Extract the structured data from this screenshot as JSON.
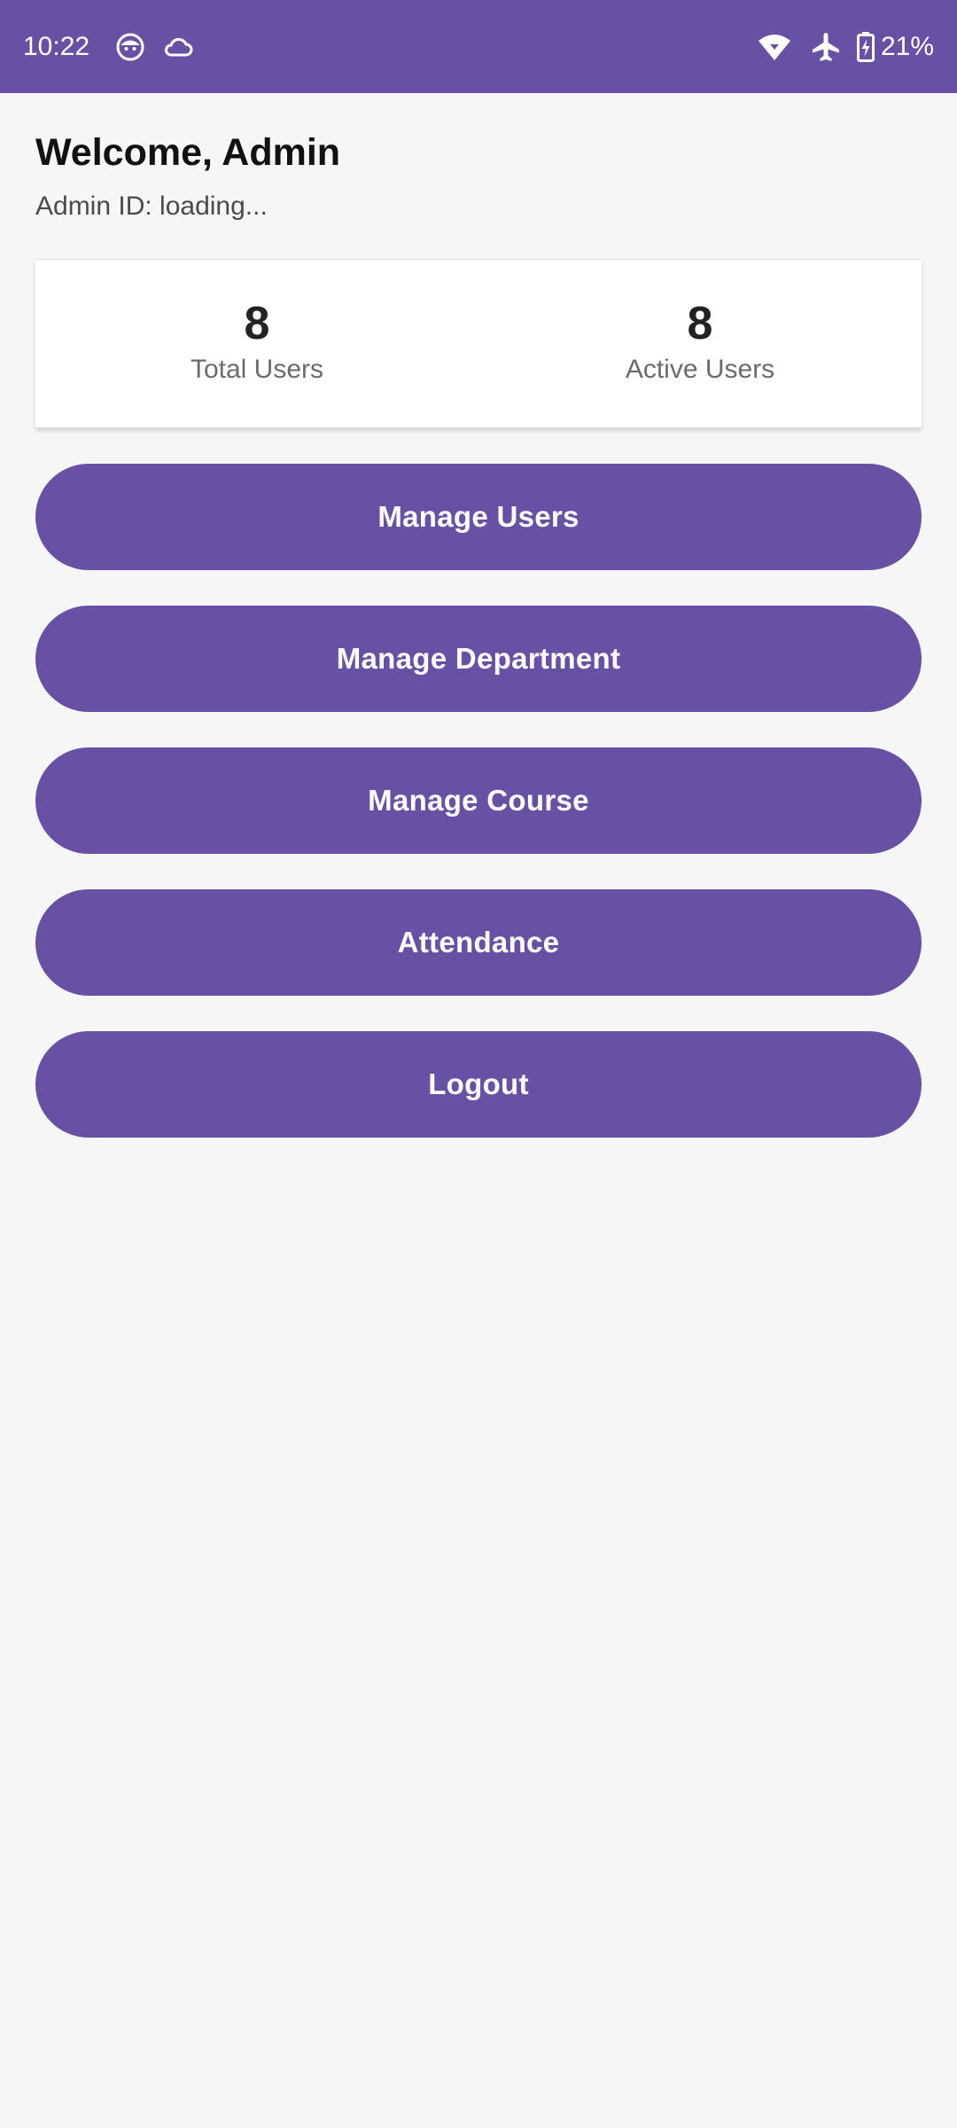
{
  "status_bar": {
    "time": "10:22",
    "battery_percent": "21%",
    "left_icons": [
      "face-notification-icon",
      "cloud-icon"
    ],
    "right_icons": [
      "wifi-icon",
      "airplane-mode-icon",
      "battery-charging-icon"
    ],
    "background_color": "#6851a5"
  },
  "header": {
    "title": "Welcome, Admin",
    "admin_id": "Admin ID: loading..."
  },
  "stats": {
    "total_users_value": "8",
    "total_users_label": "Total Users",
    "active_users_value": "8",
    "active_users_label": "Active Users"
  },
  "actions": {
    "manage_users": "Manage Users",
    "manage_department": "Manage Department",
    "manage_course": "Manage Course",
    "attendance": "Attendance",
    "logout": "Logout"
  },
  "colors": {
    "accent": "#6851a5",
    "background": "#f6f6f6",
    "card": "#ffffff"
  }
}
